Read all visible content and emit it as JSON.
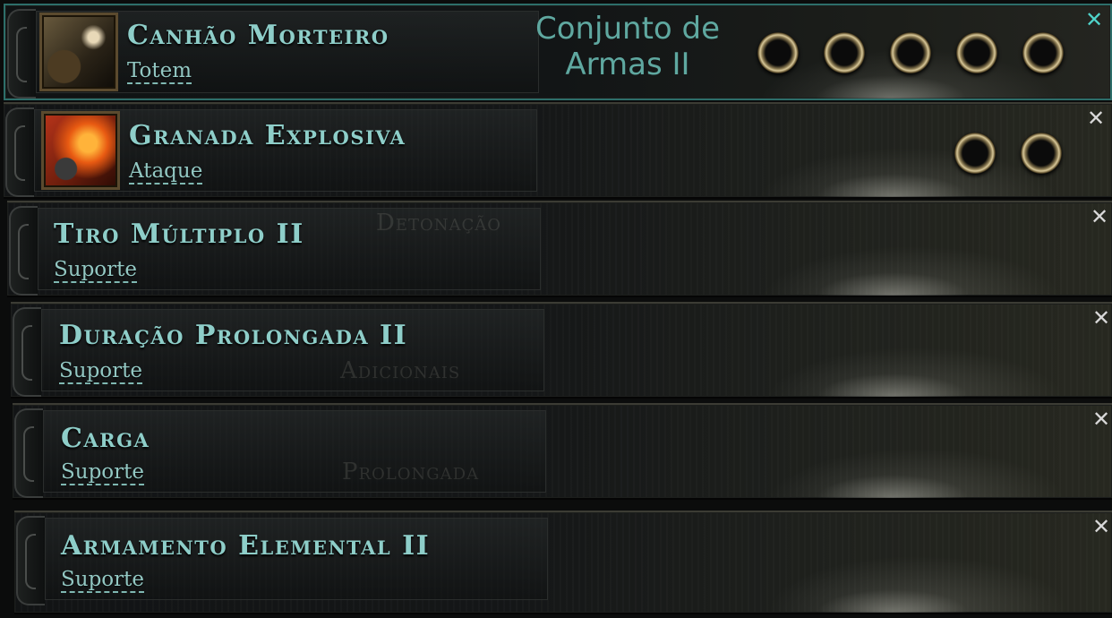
{
  "weapon_set": {
    "line1": "Conjunto de",
    "line2": "Armas II"
  },
  "close_symbol": "✕",
  "gems": [
    {
      "title": "Canhão Morteiro",
      "type": "Totem",
      "icon": "mortar-cannon-icon",
      "sockets": 5,
      "active": true
    },
    {
      "title": "Granada Explosiva",
      "type": "Ataque",
      "icon": "explosive-grenade-icon",
      "sockets": 2,
      "active": false
    },
    {
      "title": "Tiro Múltiplo II",
      "type": "Suporte",
      "sockets": 0,
      "ghost": "Detonação"
    },
    {
      "title": "Duração Prolongada II",
      "type": "Suporte",
      "sockets": 0,
      "ghost": "Adicionais"
    },
    {
      "title": "Carga",
      "type": "Suporte",
      "sockets": 0,
      "ghost": "Prolongada"
    },
    {
      "title": "Armamento Elemental II",
      "type": "Suporte",
      "sockets": 0,
      "ghost": ""
    }
  ],
  "colors": {
    "accent": "#8ecec9",
    "active_close": "#4fd2c9",
    "socket_gold": "#d8c89a"
  }
}
